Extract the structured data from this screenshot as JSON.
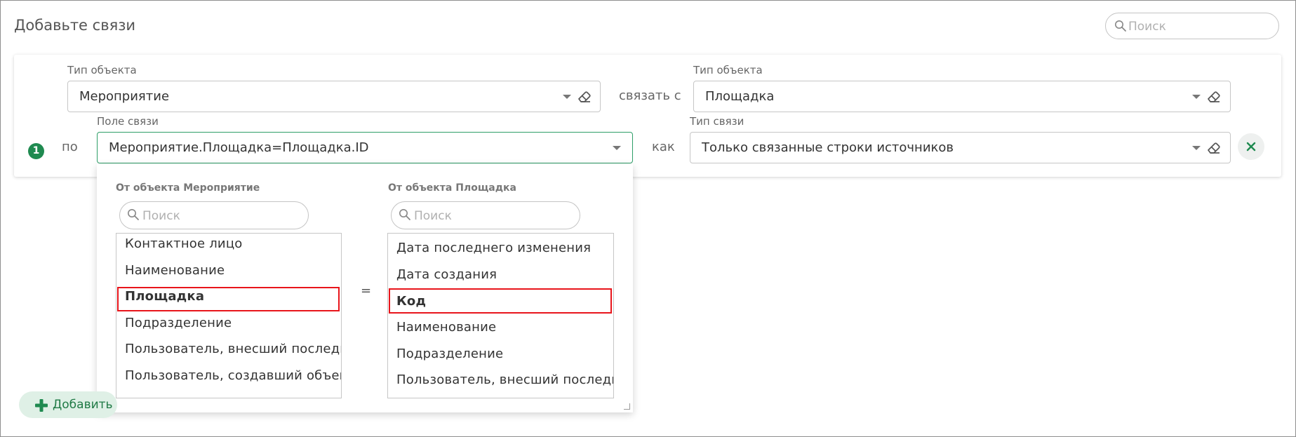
{
  "header": {
    "title": "Добавьте связи",
    "search_placeholder": "Поиск"
  },
  "link": {
    "number": "1",
    "source_type_label": "Тип объекта",
    "source_type_value": "Мероприятие",
    "connect_word": "связать с",
    "target_type_label": "Тип объекта",
    "target_type_value": "Площадка",
    "by_word": "по",
    "link_field_label": "Поле связи",
    "link_field_value": "Мероприятие.Площадка=Площадка.ID",
    "as_word": "как",
    "link_type_label": "Тип связи",
    "link_type_value": "Только связанные строки источников"
  },
  "dropdown": {
    "left_title": "От объекта Мероприятие",
    "left_search_placeholder": "Поиск",
    "left_items": [
      "Контактное лицо",
      "Наименование",
      "Площадка",
      "Подразделение",
      "Пользователь, внесший последни",
      "Пользователь, создавший объект"
    ],
    "left_selected": "Площадка",
    "equals": "=",
    "right_title": "От объекта Площадка",
    "right_search_placeholder": "Поиск",
    "right_items": [
      "Дата последнего изменения",
      "Дата создания",
      "Код",
      "Наименование",
      "Подразделение",
      "Пользователь, внесший последни"
    ],
    "right_selected": "Код"
  },
  "footer": {
    "add_label": "Добавить"
  },
  "colors": {
    "accent": "#1f8a50",
    "highlight": "#e8151b",
    "add_bg": "#dff0e6"
  }
}
